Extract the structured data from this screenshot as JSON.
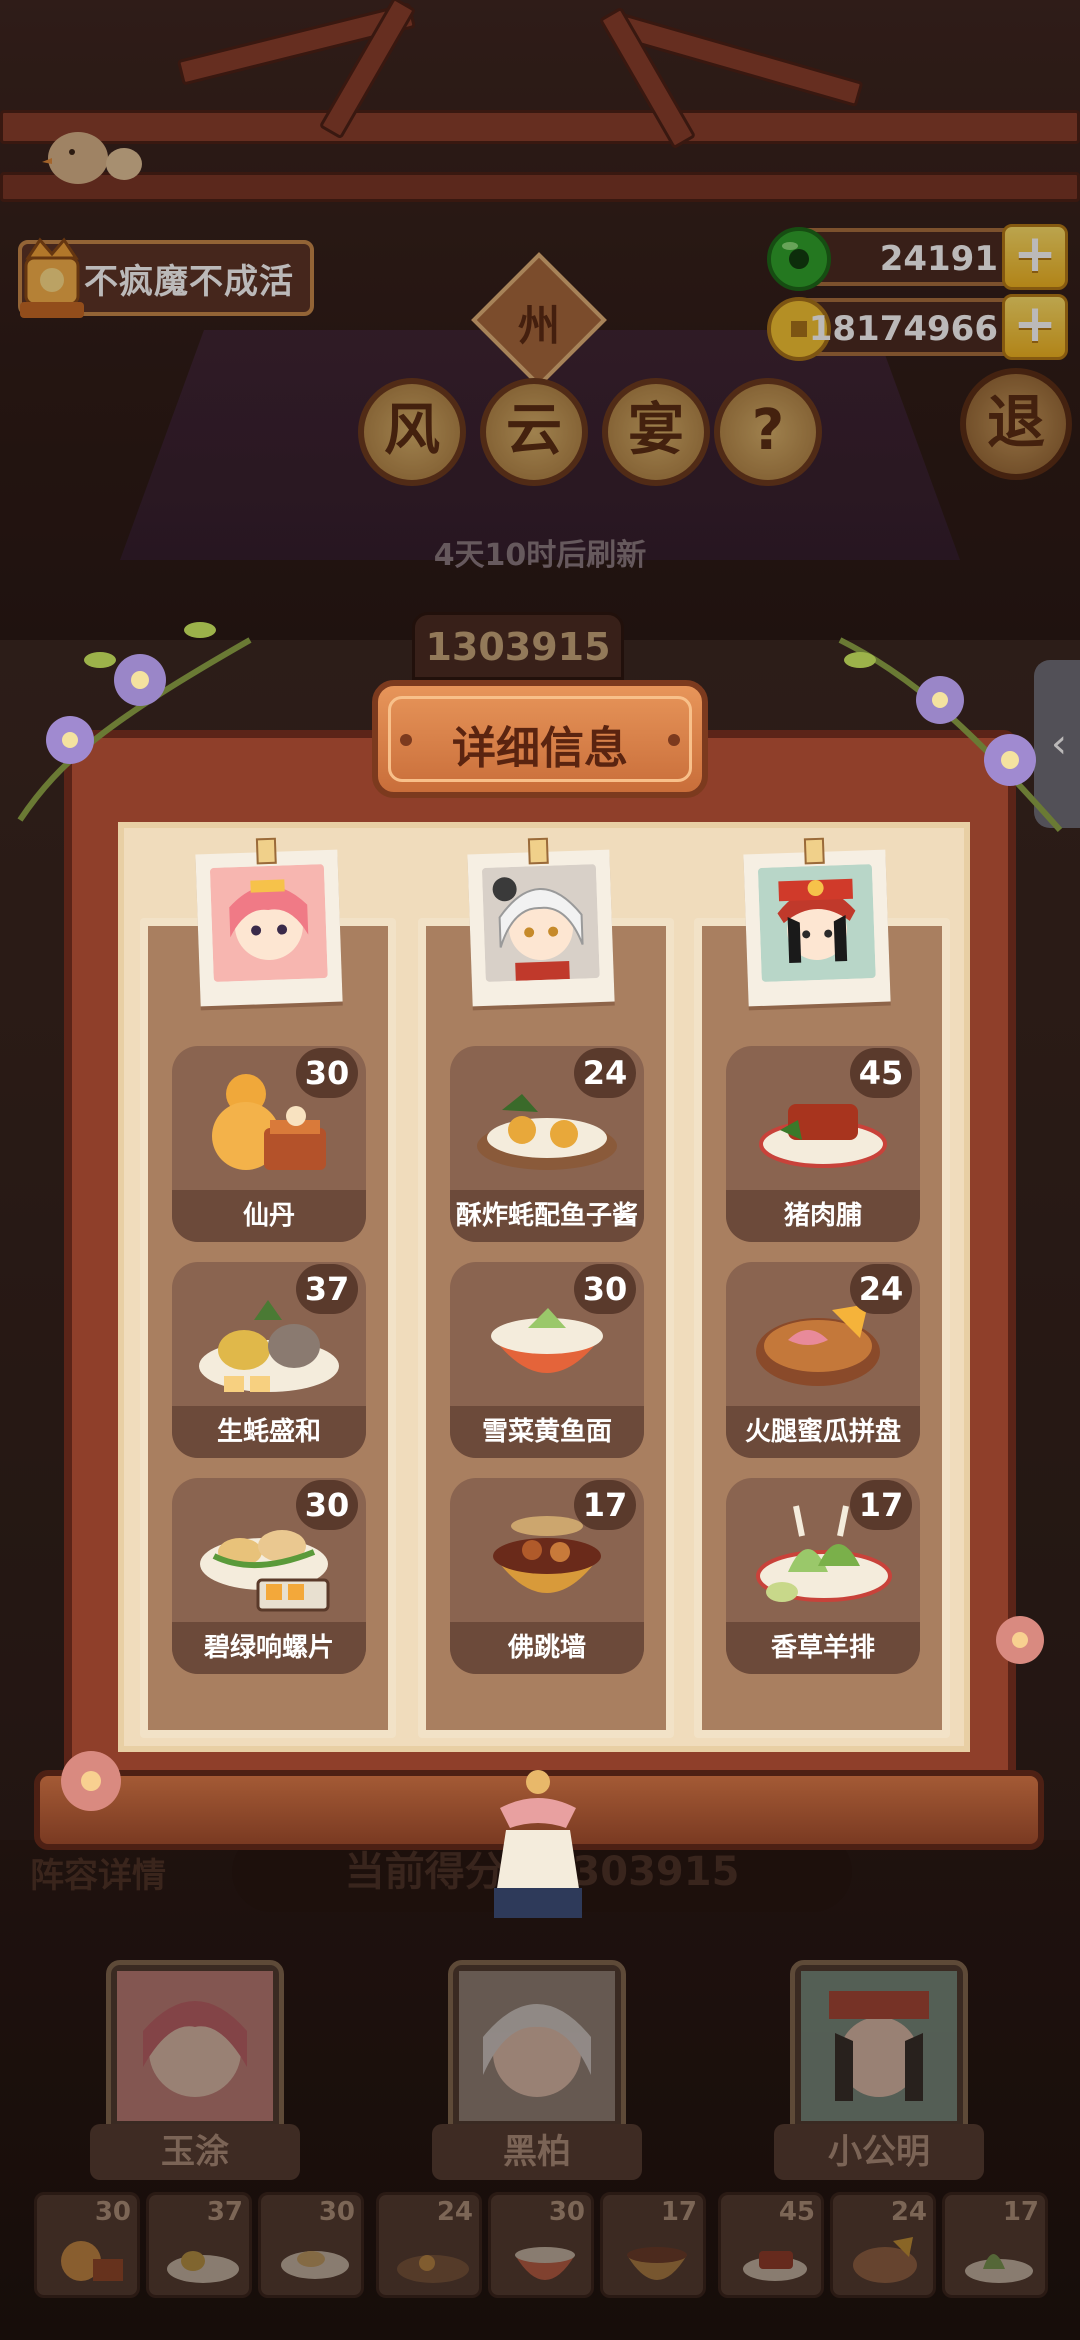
{
  "hud": {
    "player_name": "不疯魔不成活",
    "jade": "24191",
    "gold": "18174966",
    "province": "州",
    "exit_label": "退"
  },
  "event": {
    "title_chars": [
      "风",
      "云",
      "宴",
      "?"
    ],
    "refresh_text": "4天10时后刷新",
    "score": "1303915"
  },
  "dialog": {
    "title": "详细信息",
    "columns": [
      {
        "character": "玉涂",
        "dishes": [
          {
            "name": "仙丹",
            "count": "30"
          },
          {
            "name": "生蚝盛和",
            "count": "37"
          },
          {
            "name": "碧绿响螺片",
            "count": "30"
          }
        ]
      },
      {
        "character": "黑柏",
        "dishes": [
          {
            "name": "酥炸蚝配鱼子酱",
            "count": "24"
          },
          {
            "name": "雪菜黄鱼面",
            "count": "30"
          },
          {
            "name": "佛跳墙",
            "count": "17"
          }
        ]
      },
      {
        "character": "小公明",
        "dishes": [
          {
            "name": "猪肉脯",
            "count": "45"
          },
          {
            "name": "火腿蜜瓜拼盘",
            "count": "24"
          },
          {
            "name": "香草羊排",
            "count": "17"
          }
        ]
      }
    ]
  },
  "lineup": {
    "label": "阵容详情",
    "current_score": "当前得分：1303915",
    "members": [
      "玉涂",
      "黑柏",
      "小公明"
    ],
    "mini_counts": [
      "30",
      "37",
      "30",
      "24",
      "30",
      "17",
      "45",
      "24",
      "17"
    ]
  },
  "colors": {
    "accent_gold": "#f2b620",
    "wood_red": "#8f3f2a",
    "paper": "#f0dcbc"
  }
}
